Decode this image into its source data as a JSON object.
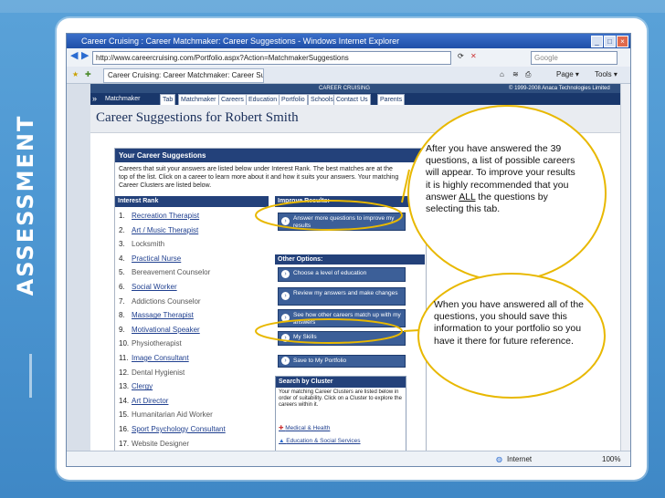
{
  "slide": {
    "side_title": "ASSESSMENT"
  },
  "browser": {
    "window_title": "Career Cruising : Career Matchmaker: Career Suggestions - Windows Internet Explorer",
    "url": "http://www.careercruising.com/Portfolio.aspx?Action=MatchmakerSuggestions",
    "search_placeholder": "Google",
    "tab_title": "Career Cruising: Career Matchmaker: Career Suggestions",
    "tools": [
      "Page ▾",
      "Tools ▾"
    ],
    "status_zone": "Internet",
    "status_zoom": "100%"
  },
  "site": {
    "brand": "CAREER CRUISING",
    "copyright": "© 1999-2008 Anaca Technologies Limited",
    "nav_items": [
      "Matchmaker",
      "Tab",
      "Matchmaker",
      "Careers",
      "Education",
      "Portfolio",
      "Schools",
      "Contact Us",
      "Parents"
    ],
    "page_title": "Career Suggestions for Robert Smith"
  },
  "content": {
    "header": "Your Career Suggestions",
    "intro": "Careers that suit your answers are listed below under Interest Rank. The best matches are at the top of the list. Click on a career to learn more about it and how it suits your answers. Your matching Career Clusters are listed below.",
    "interest_rank_label": "Interest Rank",
    "careers": [
      {
        "n": "1.",
        "name": "Recreation Therapist",
        "link": true
      },
      {
        "n": "2.",
        "name": "Art / Music Therapist",
        "link": true
      },
      {
        "n": "3.",
        "name": "Locksmith",
        "link": false
      },
      {
        "n": "4.",
        "name": "Practical Nurse",
        "link": true
      },
      {
        "n": "5.",
        "name": "Bereavement Counselor",
        "link": false
      },
      {
        "n": "6.",
        "name": "Social Worker",
        "link": true
      },
      {
        "n": "7.",
        "name": "Addictions Counselor",
        "link": false
      },
      {
        "n": "8.",
        "name": "Massage Therapist",
        "link": true
      },
      {
        "n": "9.",
        "name": "Motivational Speaker",
        "link": true
      },
      {
        "n": "10.",
        "name": "Physiotherapist",
        "link": false
      },
      {
        "n": "11.",
        "name": "Image Consultant",
        "link": true
      },
      {
        "n": "12.",
        "name": "Dental Hygienist",
        "link": false
      },
      {
        "n": "13.",
        "name": "Clergy",
        "link": true
      },
      {
        "n": "14.",
        "name": "Art Director",
        "link": true
      },
      {
        "n": "15.",
        "name": "Humanitarian Aid Worker",
        "link": false
      },
      {
        "n": "16.",
        "name": "Sport Psychology Consultant",
        "link": true
      },
      {
        "n": "17.",
        "name": "Website Designer",
        "link": false
      }
    ],
    "improve_label": "Improve Results:",
    "improve_button": "Answer more questions to improve my results",
    "other_label": "Other Options:",
    "options": [
      "Choose a level of education",
      "Review my answers and make changes",
      "See how other careers match up with my answers",
      "My Skills",
      "Save to My Portfolio"
    ],
    "cluster_label": "Search by Cluster",
    "cluster_text": "Your matching Career Clusters are listed below in order of suitability. Click on a Cluster to explore the careers within it.",
    "clusters": [
      "Medical & Health",
      "Education & Social Services"
    ]
  },
  "callouts": {
    "first": {
      "before": "After you have answered the 39 questions, a list of possible careers will appear. To improve your results it is highly recommended that you answer ",
      "emphasis": "ALL",
      "after": " the questions by selecting this tab."
    },
    "second": "When you have answered all of the questions, you should save this information to your portfolio so you have it there for future reference."
  },
  "colors": {
    "slide_background": "#4e98d3",
    "callout_outline": "#e8b800",
    "nav_blue": "#19376b"
  }
}
